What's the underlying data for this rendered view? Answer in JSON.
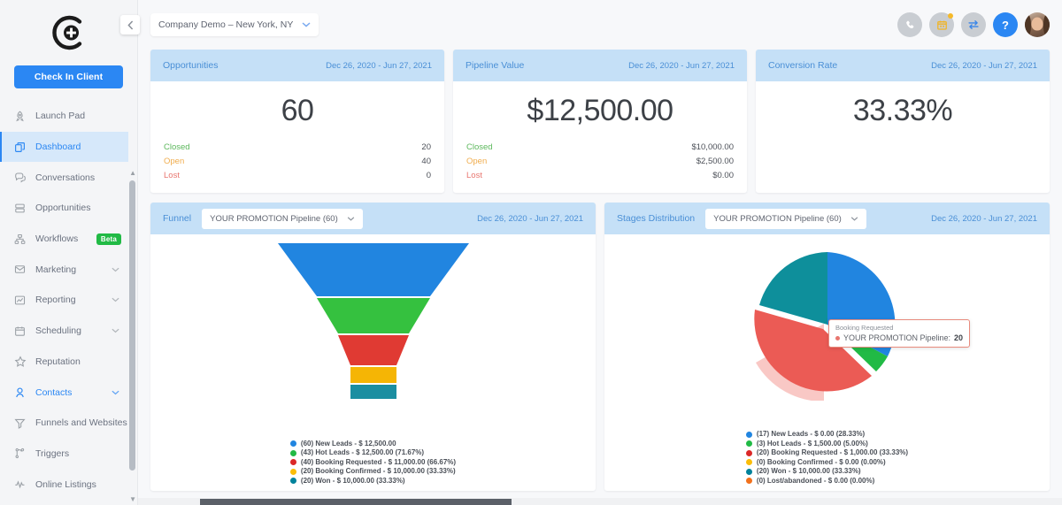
{
  "sidebar": {
    "logo_name": "c-plus-logo",
    "checkin_label": "Check In Client",
    "items": [
      {
        "label": "Launch Pad",
        "icon": "rocket-icon",
        "state": "normal",
        "chevron": false,
        "badge": null
      },
      {
        "label": "Dashboard",
        "icon": "dashboard-icon",
        "state": "active",
        "chevron": false,
        "badge": null
      },
      {
        "label": "Conversations",
        "icon": "chat-icon",
        "state": "normal",
        "chevron": false,
        "badge": null
      },
      {
        "label": "Opportunities",
        "icon": "layers-icon",
        "state": "normal",
        "chevron": false,
        "badge": null
      },
      {
        "label": "Workflows",
        "icon": "workflow-icon",
        "state": "normal",
        "chevron": false,
        "badge": "Beta"
      },
      {
        "label": "Marketing",
        "icon": "mail-icon",
        "state": "normal",
        "chevron": true,
        "badge": null
      },
      {
        "label": "Reporting",
        "icon": "chart-icon",
        "state": "normal",
        "chevron": true,
        "badge": null
      },
      {
        "label": "Scheduling",
        "icon": "calendar-icon",
        "state": "normal",
        "chevron": true,
        "badge": null
      },
      {
        "label": "Reputation",
        "icon": "star-icon",
        "state": "normal",
        "chevron": false,
        "badge": null
      },
      {
        "label": "Contacts",
        "icon": "person-icon",
        "state": "selected",
        "chevron": true,
        "badge": null
      },
      {
        "label": "Funnels and Websites",
        "icon": "funnel-icon",
        "state": "normal",
        "chevron": false,
        "badge": null
      },
      {
        "label": "Triggers",
        "icon": "branch-icon",
        "state": "normal",
        "chevron": false,
        "badge": null
      },
      {
        "label": "Online Listings",
        "icon": "pulse-icon",
        "state": "normal",
        "chevron": false,
        "badge": null
      }
    ],
    "collapse_icon": "chevron-left-icon",
    "scroll_up_icon": "caret-up-icon",
    "scroll_down_icon": "caret-down-icon"
  },
  "topbar": {
    "location": "Company Demo – New York, NY",
    "location_chevron": "chevron-down-icon",
    "icons": [
      {
        "name": "phone-icon",
        "glyph": "✆",
        "badge": false
      },
      {
        "name": "calendar-icon",
        "glyph": "▦",
        "badge": true
      },
      {
        "name": "switch-icon",
        "glyph": "⇄",
        "badge": false
      },
      {
        "name": "help-icon",
        "glyph": "?",
        "badge": false
      }
    ],
    "avatar_name": "user-avatar"
  },
  "stats": [
    {
      "title": "Opportunities",
      "date_range": "Dec 26, 2020 - Jun 27, 2021",
      "value": "60",
      "rows": [
        {
          "label": "Closed",
          "value": "20"
        },
        {
          "label": "Open",
          "value": "40"
        },
        {
          "label": "Lost",
          "value": "0"
        }
      ]
    },
    {
      "title": "Pipeline Value",
      "date_range": "Dec 26, 2020 - Jun 27, 2021",
      "value": "$12,500.00",
      "rows": [
        {
          "label": "Closed",
          "value": "$10,000.00"
        },
        {
          "label": "Open",
          "value": "$2,500.00"
        },
        {
          "label": "Lost",
          "value": "$0.00"
        }
      ]
    },
    {
      "title": "Conversion Rate",
      "date_range": "Dec 26, 2020 - Jun 27, 2021",
      "value": "33.33%",
      "rows": []
    }
  ],
  "funnel_card": {
    "title": "Funnel",
    "pipeline": "YOUR PROMOTION Pipeline (60)",
    "pipeline_chevron": "chevron-down-icon",
    "date_range": "Dec 26, 2020 - Jun 27, 2021"
  },
  "stages_card": {
    "title": "Stages Distribution",
    "pipeline": "YOUR PROMOTION Pipeline (60)",
    "pipeline_chevron": "chevron-down-icon",
    "date_range": "Dec 26, 2020 - Jun 27, 2021",
    "tooltip": {
      "title": "Booking Requested",
      "series": "YOUR PROMOTION Pipeline:",
      "value": "20"
    }
  },
  "chart_data": [
    {
      "type": "bar",
      "chart_style": "funnel",
      "title": "Funnel",
      "subtitle": "YOUR PROMOTION Pipeline (60)",
      "xlabel": "",
      "ylabel": "",
      "legend_position": "bottom",
      "grid": false,
      "categories": [
        "New Leads",
        "Hot Leads",
        "Booking Requested",
        "Booking Confirmed",
        "Won"
      ],
      "values": [
        60,
        43,
        40,
        20,
        20
      ],
      "amounts": [
        "$ 12,500.00",
        "$ 12,500.00",
        "$ 11,000.00",
        "$ 10,000.00",
        "$ 10,000.00"
      ],
      "percents": [
        null,
        "71.67%",
        "66.67%",
        "33.33%",
        "33.33%"
      ],
      "colors": [
        "#2185e0",
        "#21ba45",
        "#db2828",
        "#fbbd08",
        "#00829b"
      ],
      "legend": [
        "(60) New Leads - $ 12,500.00",
        "(43) Hot Leads - $ 12,500.00 (71.67%)",
        "(40) Booking Requested - $ 11,000.00 (66.67%)",
        "(20) Booking Confirmed - $ 10,000.00 (33.33%)",
        "(20) Won - $ 10,000.00 (33.33%)"
      ]
    },
    {
      "type": "pie",
      "title": "Stages Distribution",
      "subtitle": "YOUR PROMOTION Pipeline (60)",
      "legend_position": "bottom",
      "categories": [
        "New Leads",
        "Hot Leads",
        "Booking Requested",
        "Booking Confirmed",
        "Won",
        "Lost/abandoned"
      ],
      "values": [
        17,
        3,
        20,
        0,
        20,
        0
      ],
      "percents": [
        "28.33%",
        "5.00%",
        "33.33%",
        "0.00%",
        "33.33%",
        "0.00%"
      ],
      "amounts": [
        "$ 0.00",
        "$ 1,500.00",
        "$ 1,000.00",
        "$ 0.00",
        "$ 10,000.00",
        "$ 0.00"
      ],
      "colors": [
        "#2185e0",
        "#21ba45",
        "#db2828",
        "#fbbd08",
        "#00829b",
        "#f2711c"
      ],
      "exploded_slice": "Booking Requested",
      "legend": [
        "(17) New Leads - $ 0.00 (28.33%)",
        "(3) Hot Leads - $ 1,500.00 (5.00%)",
        "(20) Booking Requested - $ 1,000.00 (33.33%)",
        "(0) Booking Confirmed - $ 0.00 (0.00%)",
        "(20) Won - $ 10,000.00 (33.33%)",
        "(0) Lost/abandoned - $ 0.00 (0.00%)"
      ]
    }
  ],
  "theme": {
    "accent": "#2b87f3",
    "card_header_bg": "#c5e0f7",
    "card_header_text": "#4a8fd6",
    "closed": "#5cb85c",
    "open": "#f0ad4e",
    "lost": "#e8766f",
    "beta_badge": "#21ba45"
  }
}
